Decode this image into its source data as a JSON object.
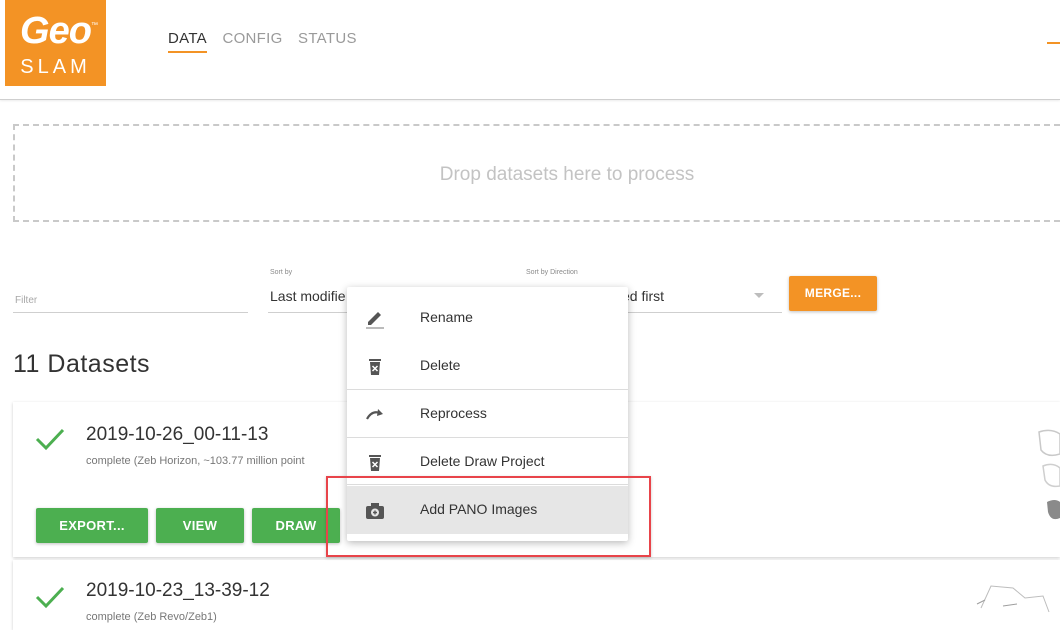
{
  "brand": {
    "logo_top": "Geo",
    "logo_bottom": "SLAM",
    "tm": "™"
  },
  "nav": {
    "tabs": [
      {
        "label": "DATA"
      },
      {
        "label": "CONFIG"
      },
      {
        "label": "STATUS"
      }
    ],
    "active": "DATA"
  },
  "dropzone": {
    "text": "Drop datasets here to process"
  },
  "filter": {
    "placeholder": "Filter"
  },
  "sort_by": {
    "label": "Sort by",
    "value": "Last modifie"
  },
  "sort_direction": {
    "label": "Sort by Direction",
    "value": "ed first"
  },
  "merge_label": "MERGE...",
  "datasets_title": "11 Datasets",
  "datasets": [
    {
      "name": "2019-10-26_00-11-13",
      "status": "complete (Zeb Horizon, ~103.77 million point"
    },
    {
      "name": "2019-10-23_13-39-12",
      "status": "complete (Zeb Revo/Zeb1)"
    }
  ],
  "card_actions": {
    "export": "EXPORT...",
    "view": "VIEW",
    "draw": "DRAW"
  },
  "context_menu": {
    "items": [
      {
        "label": "Rename",
        "icon": "pencil-icon"
      },
      {
        "label": "Delete",
        "icon": "trash-icon"
      },
      {
        "label": "Reprocess",
        "icon": "redo-icon"
      },
      {
        "label": "Delete Draw Project",
        "icon": "trash-icon"
      },
      {
        "label": "Add PANO Images",
        "icon": "camera-plus-icon"
      }
    ],
    "highlighted": "Add PANO Images"
  },
  "colors": {
    "brand_orange": "#f39325",
    "success_green": "#4caf50",
    "highlight_red": "#e8444a"
  }
}
